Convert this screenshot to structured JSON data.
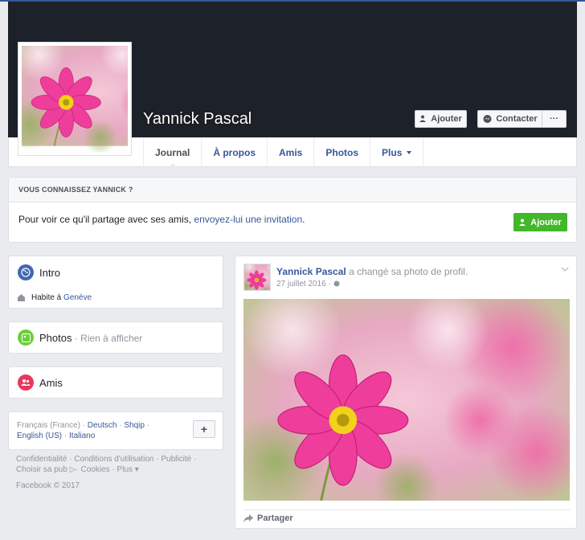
{
  "profile": {
    "name": "Yannick Pascal",
    "add_label": "Ajouter",
    "contact_label": "Contacter",
    "more_label": "···"
  },
  "tabs": [
    "Journal",
    "À propos",
    "Amis",
    "Photos",
    "Plus"
  ],
  "know": {
    "header": "VOUS CONNAISSEZ YANNICK ?",
    "text": "Pour voir ce qu'il partage avec ses amis, ",
    "link": "envoyez-lui une invitation",
    "after": ".",
    "button": "Ajouter"
  },
  "intro": {
    "title": "Intro",
    "lives_prefix": "Habite à ",
    "city": "Genève"
  },
  "photos": {
    "title": "Photos",
    "note": " · Rien à afficher"
  },
  "friends": {
    "title": "Amis"
  },
  "languages": {
    "current": "Français (France)",
    "items": [
      "Deutsch",
      "Shqip",
      "English (US)",
      "Italiano"
    ],
    "plus": "+"
  },
  "footer": {
    "links": [
      "Confidentialité",
      "Conditions d'utilisation",
      "Publicité",
      "Choisir sa pub",
      "Cookies",
      "Plus"
    ],
    "copyright": "Facebook © 2017"
  },
  "post": {
    "author": "Yannick Pascal",
    "action": " a changé sa photo de profil.",
    "date": "27 juillet 2016 ·",
    "share": "Partager"
  },
  "colors": {
    "link": "#365899",
    "cover": "#1d2129",
    "green": "#42b72a",
    "background": "#e9ebee"
  }
}
